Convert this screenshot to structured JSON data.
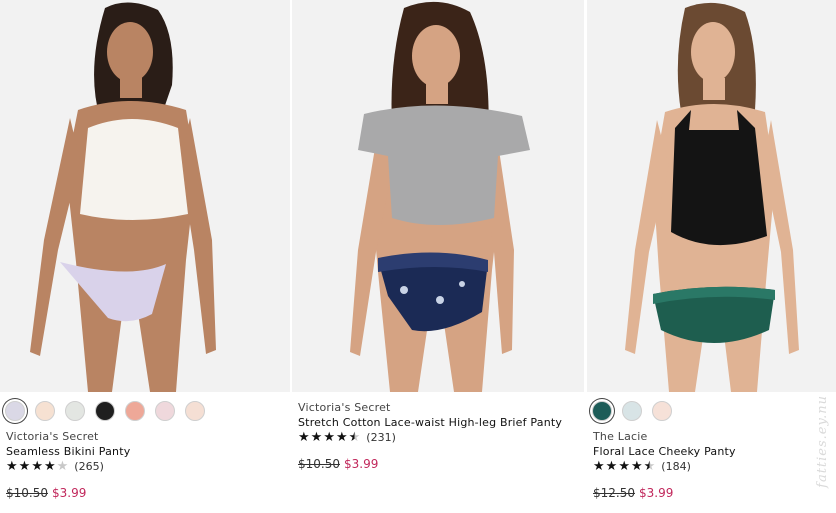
{
  "products": [
    {
      "brand": "Victoria's Secret",
      "name": "Seamless Bikini Panty",
      "rating": 4.0,
      "reviews": "(265)",
      "original_price": "$10.50",
      "sale_price": "$3.99",
      "swatches": [
        "#dad8e6",
        "#f6e1d2",
        "#e3e6e2",
        "#1f1f1f",
        "#eea898",
        "#efd8dc",
        "#f5dfd4"
      ],
      "selected_swatch": 0
    },
    {
      "brand": "Victoria's Secret",
      "name": "Stretch Cotton Lace-waist High-leg Brief Panty",
      "rating": 4.5,
      "reviews": "(231)",
      "original_price": "$10.50",
      "sale_price": "$3.99",
      "swatches": []
    },
    {
      "brand": "The Lacie",
      "name": "Floral Lace Cheeky Panty",
      "rating": 4.5,
      "reviews": "(184)",
      "original_price": "$12.50",
      "sale_price": "$3.99",
      "swatches": [
        "#1d5c58",
        "#d8e4e6",
        "#f6e1d8"
      ],
      "selected_swatch": 0
    }
  ],
  "watermark": "fatties.ey.nu",
  "colors": {
    "sale": "#c1275b",
    "panty_1": "#d9d2ea",
    "panty_2": "#1b2a55",
    "panty_3": "#1e5e4f"
  }
}
